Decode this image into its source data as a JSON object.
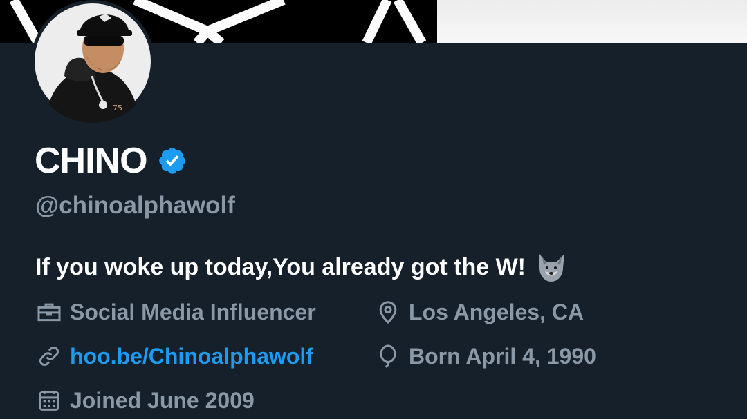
{
  "profile": {
    "name": "CHINO",
    "handle": "@chinoalphawolf",
    "bio": "If you woke up today,You already got the W!",
    "bio_emoji": "wolf-emoji",
    "category": "Social Media Influencer",
    "location": "Los Angeles, CA",
    "website": "hoo.be/Chinoalphawolf",
    "birthday": "Born April 4, 1990",
    "joined": "Joined June 2009"
  },
  "icons": {
    "category": "briefcase-icon",
    "location": "location-pin-icon",
    "website": "link-icon",
    "birthday": "balloon-icon",
    "joined": "calendar-icon",
    "verified": "verified-badge-icon"
  },
  "colors": {
    "background": "#15202b",
    "text_primary": "#ffffff",
    "text_secondary": "#8b98a5",
    "link": "#1d9bf0",
    "verified": "#1d9bf0"
  }
}
